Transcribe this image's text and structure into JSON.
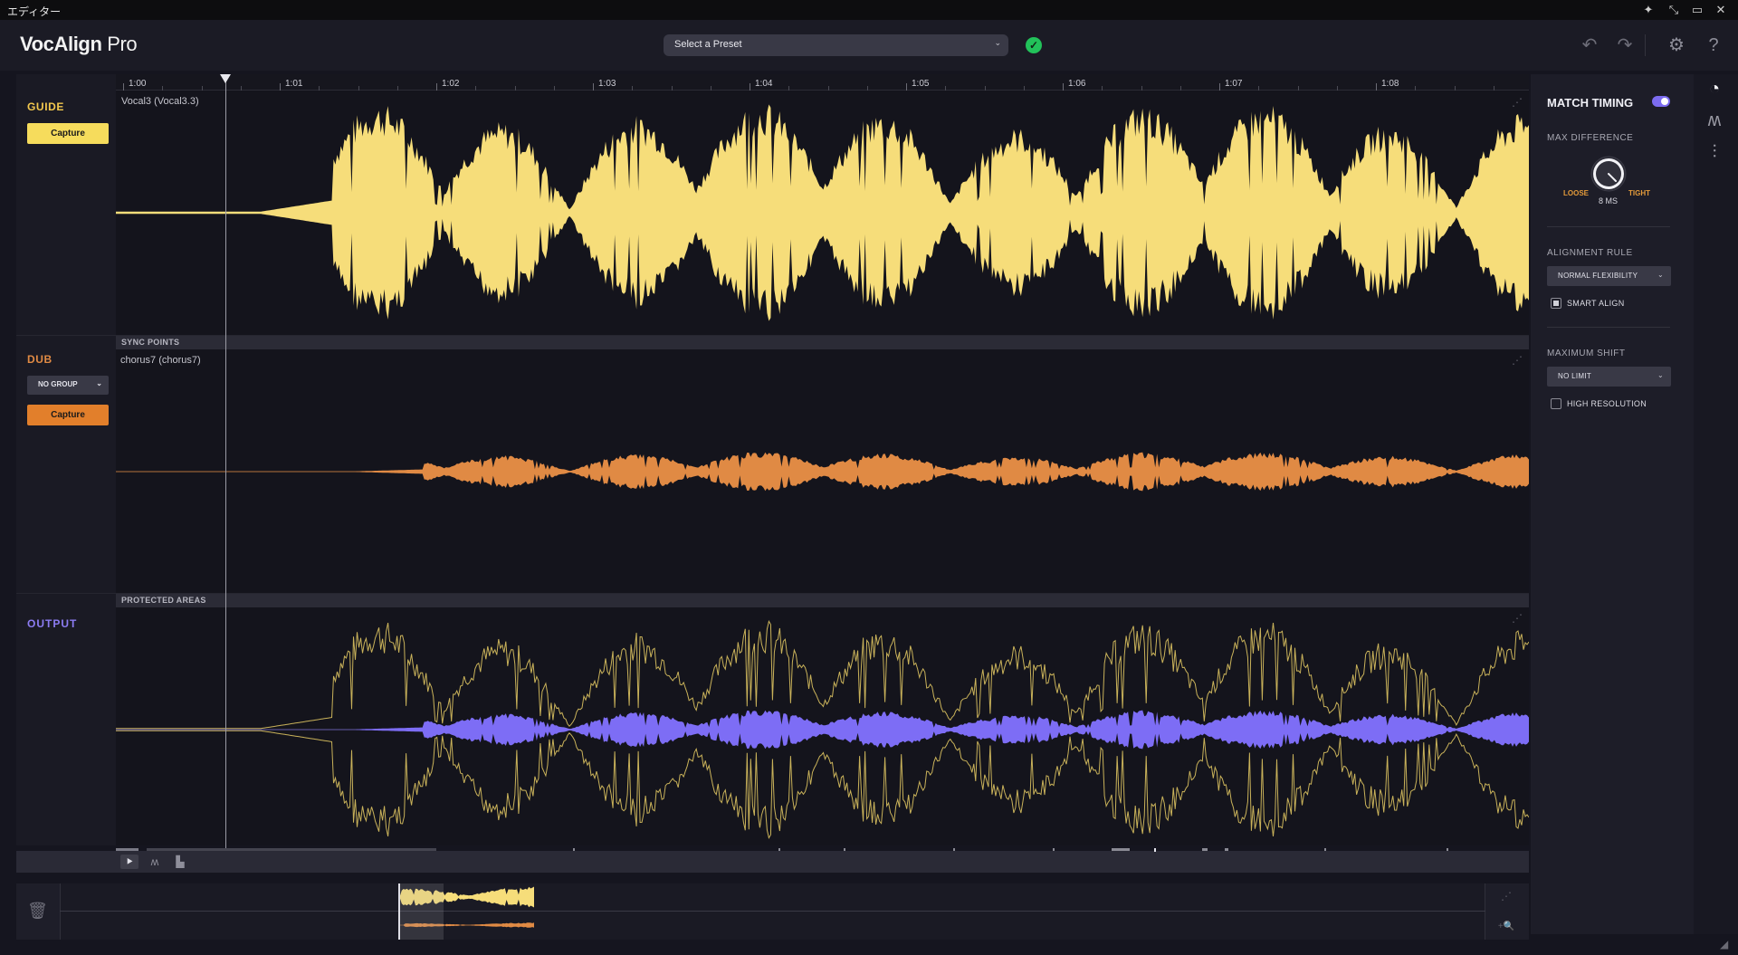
{
  "window": {
    "title": "エディター",
    "buttons": [
      "pin-icon",
      "collapse-icon",
      "restore-icon",
      "close-icon"
    ]
  },
  "header": {
    "logo_bold": "VocAlign",
    "logo_light": " Pro",
    "preset_label": "Select a Preset",
    "preset_chevron": "⌄",
    "status_icon": "check-circle-icon",
    "actions": [
      "undo-icon",
      "redo-icon",
      "gear-icon",
      "help-icon"
    ]
  },
  "timeline": {
    "labels": [
      "1:00",
      "1:01",
      "1:02",
      "1:03",
      "1:04",
      "1:05",
      "1:06",
      "1:07",
      "1:08"
    ]
  },
  "guide": {
    "label": "GUIDE",
    "capture_label": "Capture",
    "track_name": "Vocal3 (Vocal3.3)",
    "color": "#f6dd7a"
  },
  "sync_points_label": "SYNC POINTS",
  "dub": {
    "label": "DUB",
    "group_label": "NO GROUP",
    "group_chevron": "⌄",
    "capture_label": "Capture",
    "track_name": "chorus7 (chorus7)",
    "color": "#e08a44"
  },
  "protected_areas_label": "PROTECTED AREAS",
  "output": {
    "label": "OUTPUT",
    "color": "#7d6df5"
  },
  "right_panel": {
    "match_timing_label": "MATCH TIMING",
    "match_timing_on": true,
    "max_difference_label": "MAX DIFFERENCE",
    "loose_label": "LOOSE",
    "tight_label": "TIGHT",
    "knob_value": "8 MS",
    "alignment_rule_label": "ALIGNMENT RULE",
    "alignment_rule_value": "NORMAL FLEXIBILITY",
    "smart_align_label": "SMART ALIGN",
    "smart_align_checked": true,
    "maximum_shift_label": "MAXIMUM SHIFT",
    "maximum_shift_value": "NO LIMIT",
    "high_resolution_label": "HIGH RESOLUTION",
    "high_resolution_checked": false,
    "chevron": "⌄"
  },
  "side_tools": [
    "timing-clock-icon",
    "pitch-wave-icon",
    "mixer-sliders-icon"
  ]
}
